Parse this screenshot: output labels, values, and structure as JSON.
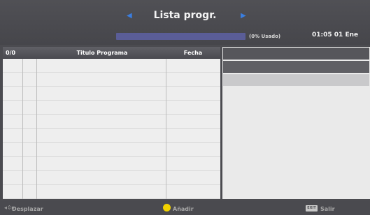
{
  "header": {
    "title": "Lista progr.",
    "left_arrow_icon": "triangle-left-icon",
    "right_arrow_icon": "triangle-right-icon",
    "usage_text": "(0% Usado)",
    "usage_percent": 0,
    "clock": "01:05 01 Ene"
  },
  "table": {
    "count": "0/0",
    "title_header": "Titulo Programa",
    "date_header": "Fecha",
    "rows": []
  },
  "footer": {
    "move_icon": "arrows-updown-icon",
    "move_label": "Desplazar",
    "add_label": "Añadir",
    "exit_key_label": "EXIT",
    "exit_label": "Salir"
  },
  "colors": {
    "accent_arrow": "#3a7ee0",
    "progress_bar": "#5a5d97",
    "yellow_button": "#f2d200"
  }
}
